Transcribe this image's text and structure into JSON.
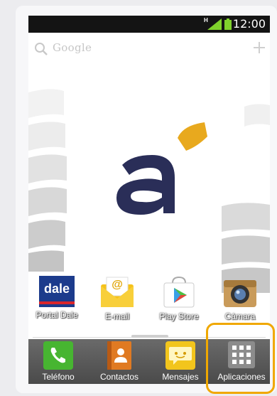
{
  "status_bar": {
    "time": "12:00",
    "network": "H"
  },
  "search": {
    "text": "Google"
  },
  "home_apps": [
    {
      "label": "Portal Dale",
      "icon_text": "dale"
    },
    {
      "label": "E-mail",
      "icon_text": "@"
    },
    {
      "label": "Play Store"
    },
    {
      "label": "Cámara"
    }
  ],
  "dock": [
    {
      "label": "Teléfono"
    },
    {
      "label": "Contactos"
    },
    {
      "label": "Mensajes"
    },
    {
      "label": "Aplicaciones"
    }
  ],
  "colors": {
    "highlight": "#f0a800",
    "logo_navy": "#2a2e58",
    "logo_orange": "#e8a91e",
    "phone_green": "#47b531",
    "contacts_orange": "#e07a22",
    "messages_yellow": "#f2c51c"
  }
}
